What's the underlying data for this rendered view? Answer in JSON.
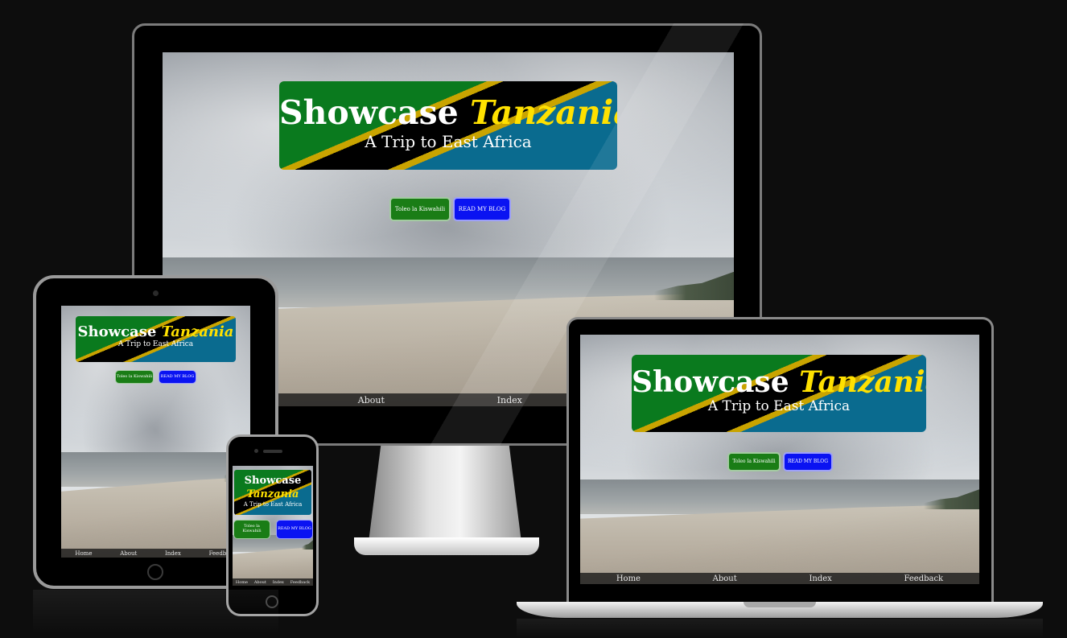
{
  "site": {
    "title_main": "Showcase",
    "title_accent": "Tanzania",
    "subtitle": "A Trip to East Africa",
    "buttons": {
      "swahili": "Toleo la Kiswahili",
      "blog": "READ MY BLOG"
    },
    "nav": [
      "Home",
      "About",
      "Index",
      "Feedback"
    ]
  },
  "colors": {
    "page_background": "#0d0d0d",
    "flag_green": "#0a7a1e",
    "flag_yellow": "#c9a400",
    "flag_black": "#000000",
    "flag_blue": "#0a6b8f",
    "accent_text": "#ffe100",
    "button_green": "#1a7d16",
    "button_blue": "#0a13f2"
  }
}
